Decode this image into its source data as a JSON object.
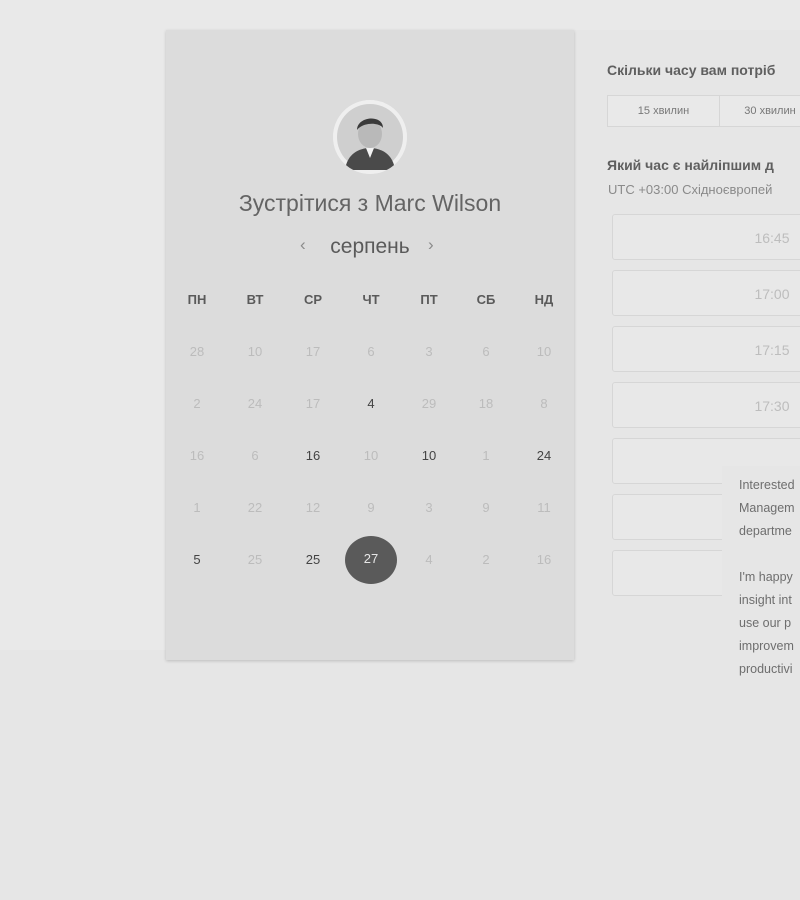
{
  "booking_card": {
    "title": "Зустрітися з Marc Wilson",
    "month_label": "серпень",
    "prev_icon": "‹",
    "next_icon": "›",
    "weekdays": [
      "ПН",
      "ВТ",
      "СР",
      "ЧТ",
      "ПТ",
      "СБ",
      "НД"
    ],
    "weeks": [
      [
        "28",
        "10",
        "17",
        "6",
        "3",
        "6",
        "10"
      ],
      [
        "2",
        "24",
        "17",
        "4",
        "29",
        "18",
        "8"
      ],
      [
        "16",
        "6",
        "16",
        "10",
        "10",
        "1",
        "24"
      ],
      [
        "1",
        "22",
        "12",
        "9",
        "3",
        "9",
        "11"
      ],
      [
        "5",
        "25",
        "25",
        "27",
        "4",
        "2",
        "16"
      ]
    ],
    "active_days": [
      [
        1,
        3
      ],
      [
        2,
        2
      ],
      [
        2,
        4
      ],
      [
        2,
        6
      ],
      [
        4,
        0
      ],
      [
        4,
        2
      ]
    ],
    "selected_day": [
      4,
      3
    ]
  },
  "duration_section": {
    "question": "Скільки часу вам потріб",
    "tabs": [
      "15 хвилин",
      "30 хвилин"
    ]
  },
  "time_section": {
    "question": "Який час є найліпшим д",
    "timezone": "UTC +03:00 Східноєвропей",
    "slots": [
      "16:45",
      "17:00",
      "17:15",
      "17:30",
      "",
      "",
      ""
    ]
  },
  "tooltip": {
    "lines_1": [
      "Interested",
      "Managem",
      "departme"
    ],
    "lines_2": [
      "I'm happy",
      "insight int",
      "use our p",
      "improvem",
      "productivi"
    ]
  },
  "colors": {
    "background": "#e6e6e6",
    "card": "#dcdcdc",
    "selected_day": "#5a5a5a"
  }
}
